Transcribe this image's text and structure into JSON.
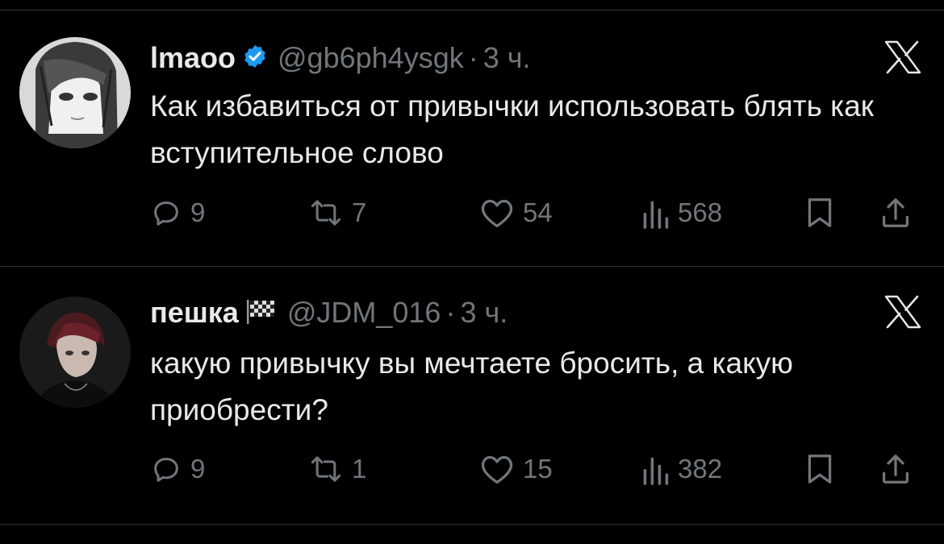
{
  "tweets": [
    {
      "name": "lmaoo",
      "handle": "@gb6ph4ysgk",
      "separator": "·",
      "time": "3 ч.",
      "verified": true,
      "text": "Как избавиться от привычки использовать блять как вступительное слово",
      "replies": "9",
      "retweets": "7",
      "likes": "54",
      "views": "568"
    },
    {
      "name": "пешка",
      "handle": "@JDM_016",
      "separator": "·",
      "time": "3 ч.",
      "verified": false,
      "text": "какую привычку вы мечтаете бросить, а какую приобрести?",
      "replies": "9",
      "retweets": "1",
      "likes": "15",
      "views": "382"
    }
  ],
  "icons": {
    "badge": "verified-badge-icon",
    "flag": "checkered-flag-icon",
    "platform": "x-logo-icon",
    "reply": "reply-icon",
    "retweet": "retweet-icon",
    "like": "heart-icon",
    "views": "views-icon",
    "bookmark": "bookmark-icon",
    "share": "share-icon"
  },
  "colors": {
    "background": "#000000",
    "text": "#e7e9ea",
    "secondary": "#71767b",
    "verified": "#1d9bf0",
    "divider": "#2f3336"
  }
}
